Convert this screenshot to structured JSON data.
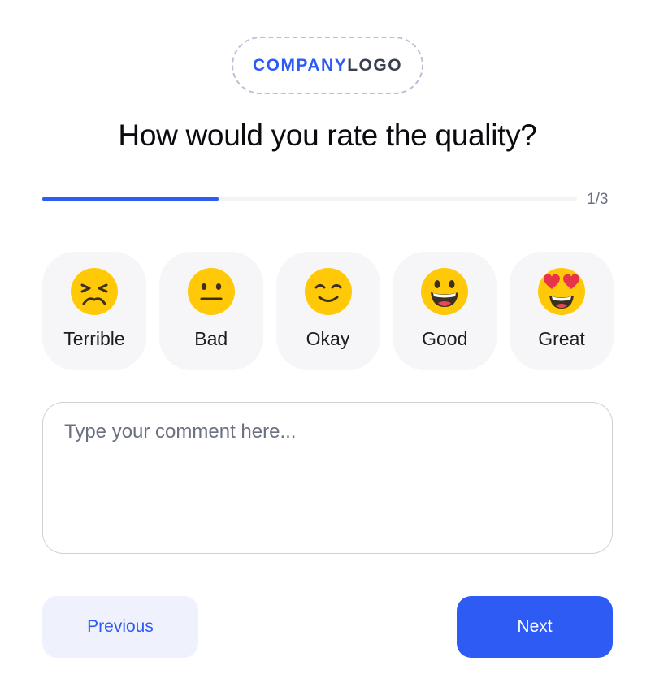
{
  "logo": {
    "company": "COMPANY",
    "logo": "LOGO"
  },
  "title": "How would you rate the quality?",
  "progress": {
    "label": "1/3",
    "fraction": 0.33
  },
  "ratings": [
    {
      "label": "Terrible",
      "icon": "tired-face-icon"
    },
    {
      "label": "Bad",
      "icon": "neutral-face-icon"
    },
    {
      "label": "Okay",
      "icon": "slightly-smiling-face-icon"
    },
    {
      "label": "Good",
      "icon": "grinning-face-icon"
    },
    {
      "label": "Great",
      "icon": "heart-eyes-face-icon"
    }
  ],
  "comment": {
    "placeholder": "Type your comment here...",
    "value": ""
  },
  "buttons": {
    "previous": "Previous",
    "next": "Next"
  },
  "colors": {
    "accent": "#2f5bf5",
    "emoji_face": "#ffc908",
    "secondary_button_bg": "#eff2fd"
  }
}
